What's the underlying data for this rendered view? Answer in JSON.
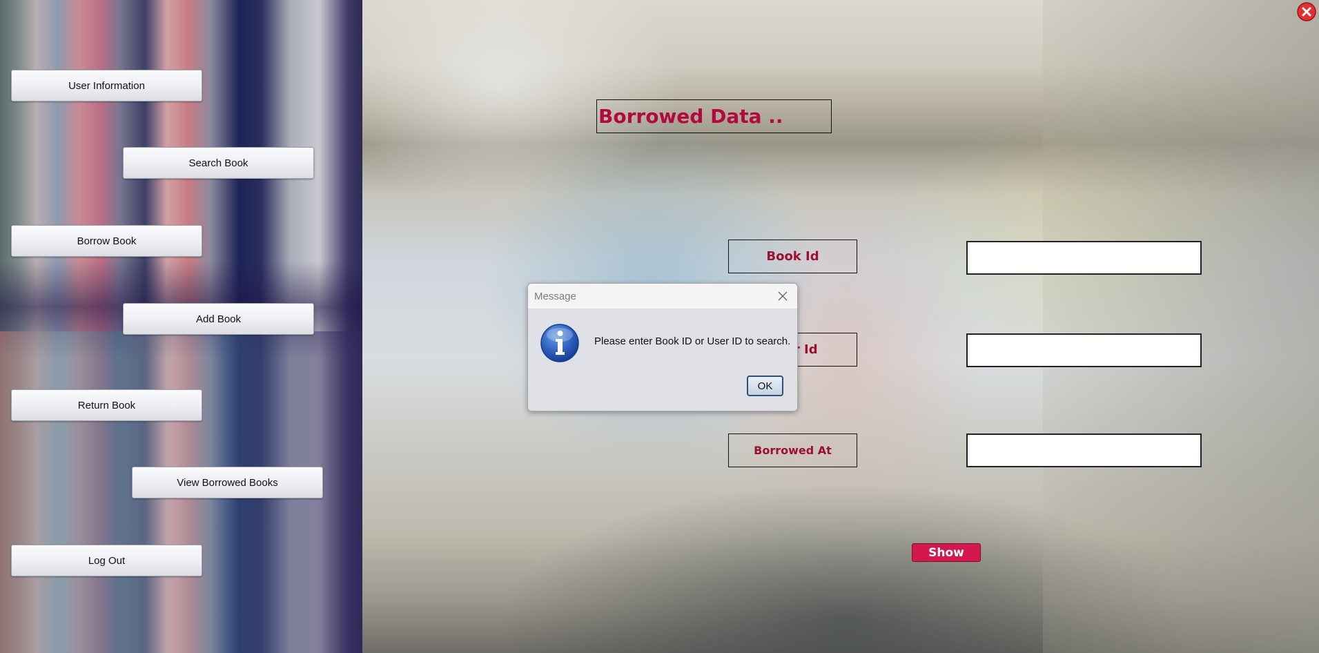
{
  "sidebar": {
    "buttons": [
      {
        "label": "User Information"
      },
      {
        "label": "Search Book"
      },
      {
        "label": "Borrow Book"
      },
      {
        "label": "Add Book"
      },
      {
        "label": "Return Book"
      },
      {
        "label": "View Borrowed Books"
      },
      {
        "label": "Log Out"
      }
    ]
  },
  "main": {
    "title": "Borrowed Data ..",
    "fields": [
      {
        "label": "Book Id",
        "value": ""
      },
      {
        "label": "User Id",
        "value": ""
      },
      {
        "label": "Borrowed At",
        "value": ""
      }
    ],
    "show_label": "Show"
  },
  "dialog": {
    "title": "Message",
    "message": "Please enter Book ID or User ID to search.",
    "ok_label": "OK",
    "icon": "info-icon"
  },
  "window": {
    "close_icon": "close-icon"
  },
  "colors": {
    "title": "#b10a3f",
    "label": "#9b0f33",
    "show_button": "#d3184f",
    "close_button": "#e0302f"
  }
}
